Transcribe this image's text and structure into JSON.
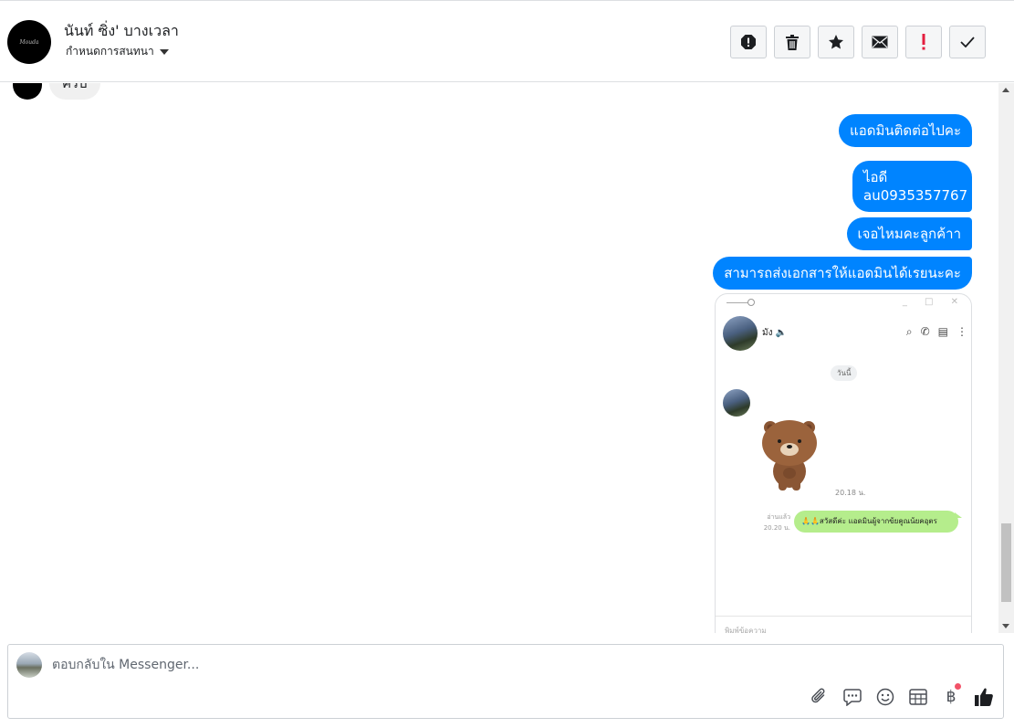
{
  "header": {
    "avatar_text": "Mouda",
    "contact_name": "นันท์ ซิ่ง' บางเวลา",
    "settings_label": "กำหนดการสนทนา"
  },
  "toolbar": {
    "buttons": [
      "report-icon",
      "trash-icon",
      "star-icon",
      "envelope-icon",
      "exclamation-icon",
      "check-icon"
    ],
    "exclamation_color": "#e41e3f"
  },
  "conversation": {
    "incoming_partial": "ครับ",
    "outgoing": [
      "แอดมินติดต่อไปคะ",
      "ไอดี au0935357767",
      "เจอไหมคะลูกค้าา",
      "สามารถส่งเอกสารให้แอดมินได้เรยนะคะ"
    ],
    "bubble_color": "#0084ff"
  },
  "attachment": {
    "contact_name": "มัง",
    "date_chip": "วันนี้",
    "sticker_time": "20.18 น.",
    "read_label": "อ่านแล้ว",
    "reply_time": "20.20 น.",
    "reply_text": "🙏🙏สวัสดีค่ะ แอดมินผู้จากข้ยคูณน้ยคอุตร",
    "input_placeholder": "พิมพ์ข้อความ"
  },
  "composer": {
    "placeholder": "ตอบกลับใน Messenger...",
    "baht_symbol": "฿",
    "tools": [
      "paperclip-icon",
      "saved-reply-icon",
      "emoji-icon",
      "table-icon",
      "baht-icon",
      "like-icon"
    ]
  }
}
